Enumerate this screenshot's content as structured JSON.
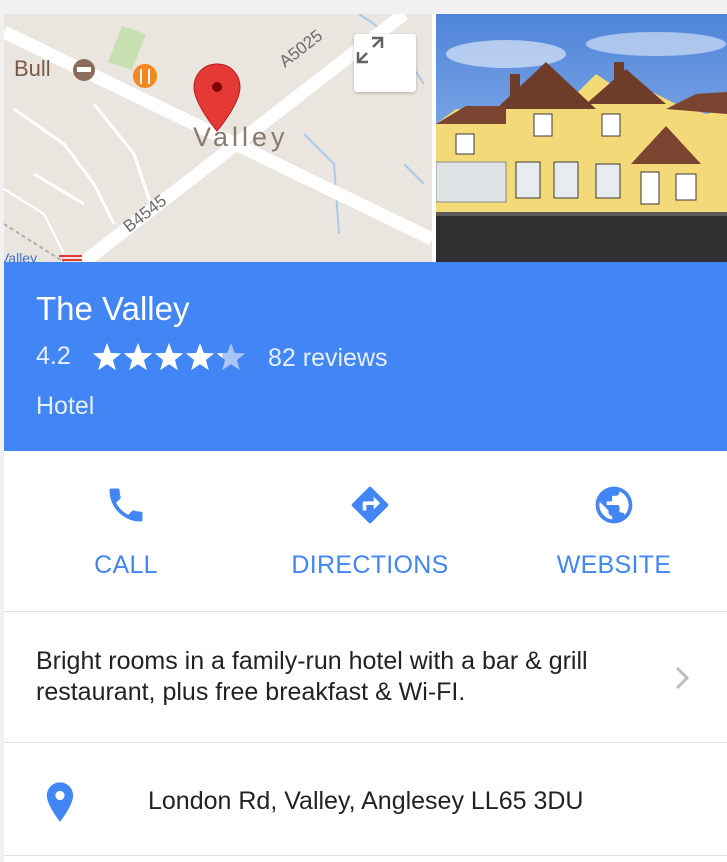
{
  "map": {
    "labels": {
      "bull": "Bull",
      "valley_town": "Valley",
      "road_a5025": "A5025",
      "road_b4545": "B4545",
      "station": "Valley"
    }
  },
  "place": {
    "name": "The Valley",
    "rating": "4.2",
    "rating_value": 4.2,
    "rating_max": 5,
    "reviews": "82 reviews",
    "category": "Hotel"
  },
  "actions": {
    "call": "CALL",
    "directions": "DIRECTIONS",
    "website": "WEBSITE"
  },
  "description": "Bright rooms in a family-run hotel with a bar & grill restaurant, plus free breakfast & Wi-FI.",
  "address": "London Rd, Valley, Anglesey LL65 3DU",
  "colors": {
    "accent": "#4285f4",
    "map_pin": "#e53935",
    "food_poi": "#f5871f",
    "map_bg": "#eae6df"
  },
  "icons": {
    "expand": "expand-icon",
    "call": "phone-icon",
    "directions": "directions-icon",
    "website": "globe-icon",
    "chevron": "chevron-right-icon",
    "location": "location-pin-icon"
  }
}
